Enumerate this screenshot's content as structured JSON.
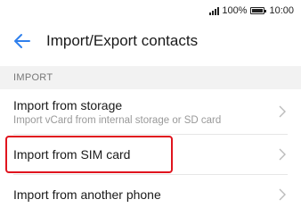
{
  "status_bar": {
    "battery": "100%",
    "time": "10:00",
    "battery_level": 1.0
  },
  "header": {
    "back_icon": "arrow-left-icon",
    "title": "Import/Export contacts",
    "accent_color": "#2f80ed"
  },
  "section": {
    "label": "IMPORT"
  },
  "items": [
    {
      "label": "Import from storage",
      "sub": "Import vCard from internal storage or SD card"
    },
    {
      "label": "Import from SIM card",
      "sub": ""
    },
    {
      "label": "Import from another phone",
      "sub": ""
    }
  ],
  "highlight_color": "#e0141e"
}
